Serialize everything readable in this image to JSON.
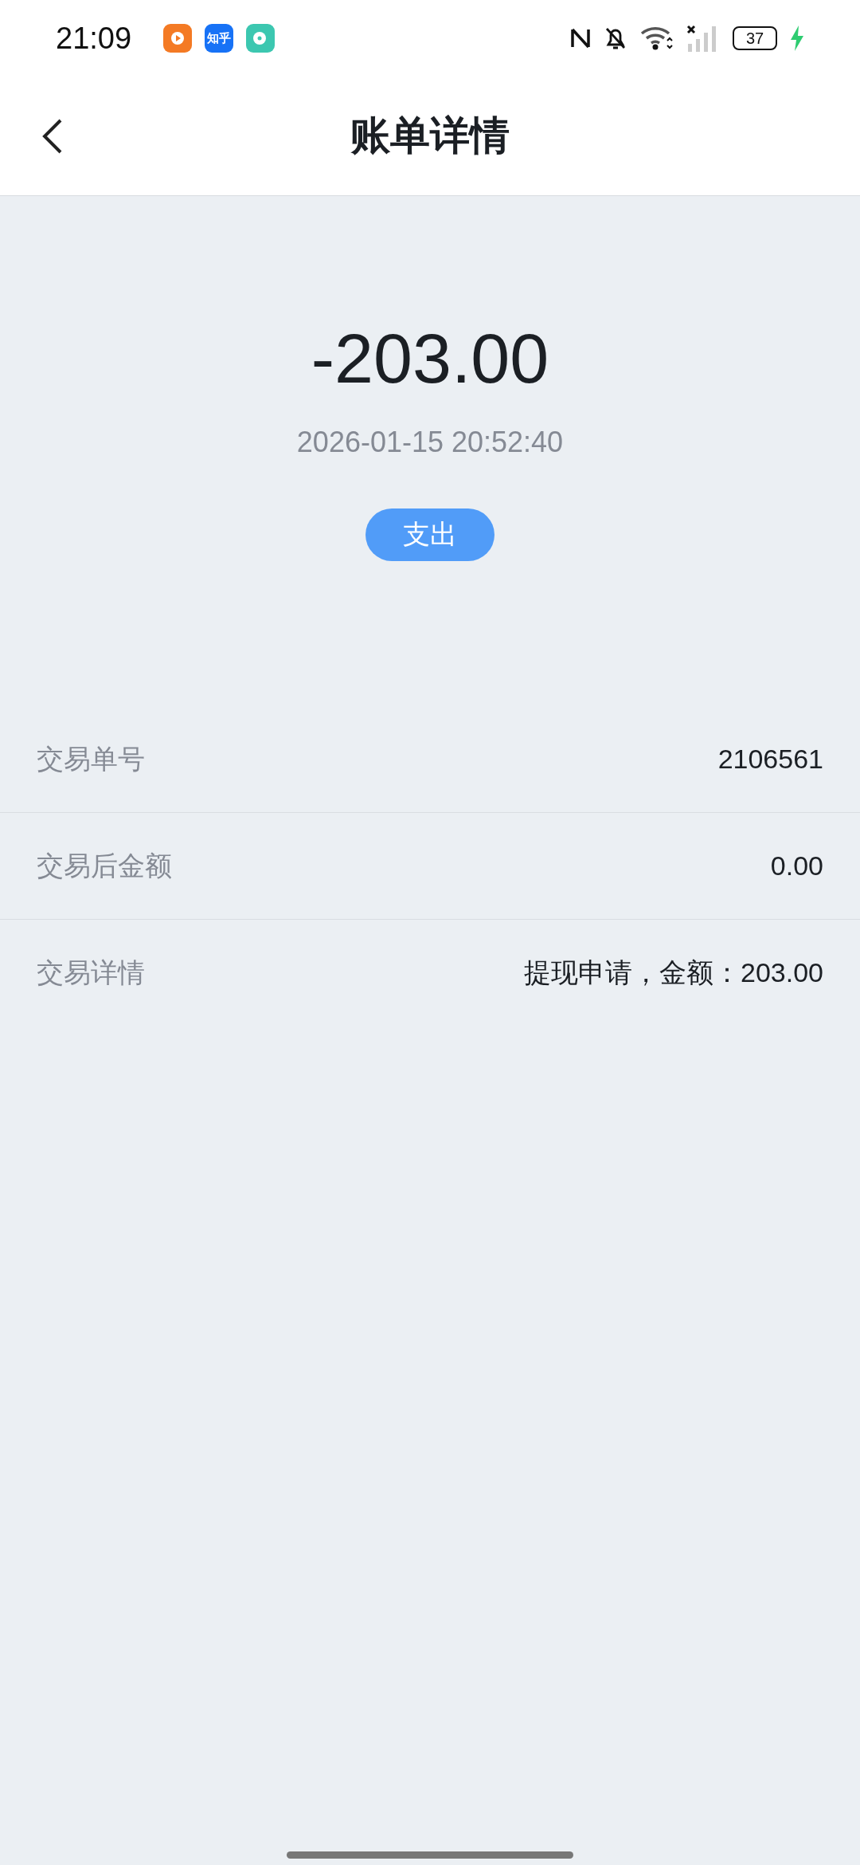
{
  "status_bar": {
    "time": "21:09",
    "notification_apps": [
      {
        "kind": "video"
      },
      {
        "kind": "text",
        "label": "知乎"
      },
      {
        "kind": "music"
      }
    ],
    "battery": "37",
    "charging": true
  },
  "header": {
    "title": "账单详情"
  },
  "summary": {
    "amount": "-203.00",
    "datetime": "2026-01-15 20:52:40",
    "type_tag": "支出"
  },
  "details": [
    {
      "label": "交易单号",
      "value": "2106561"
    },
    {
      "label": "交易后金额",
      "value": "0.00"
    },
    {
      "label": "交易详情",
      "value": "提现申请，金额：203.00"
    }
  ]
}
